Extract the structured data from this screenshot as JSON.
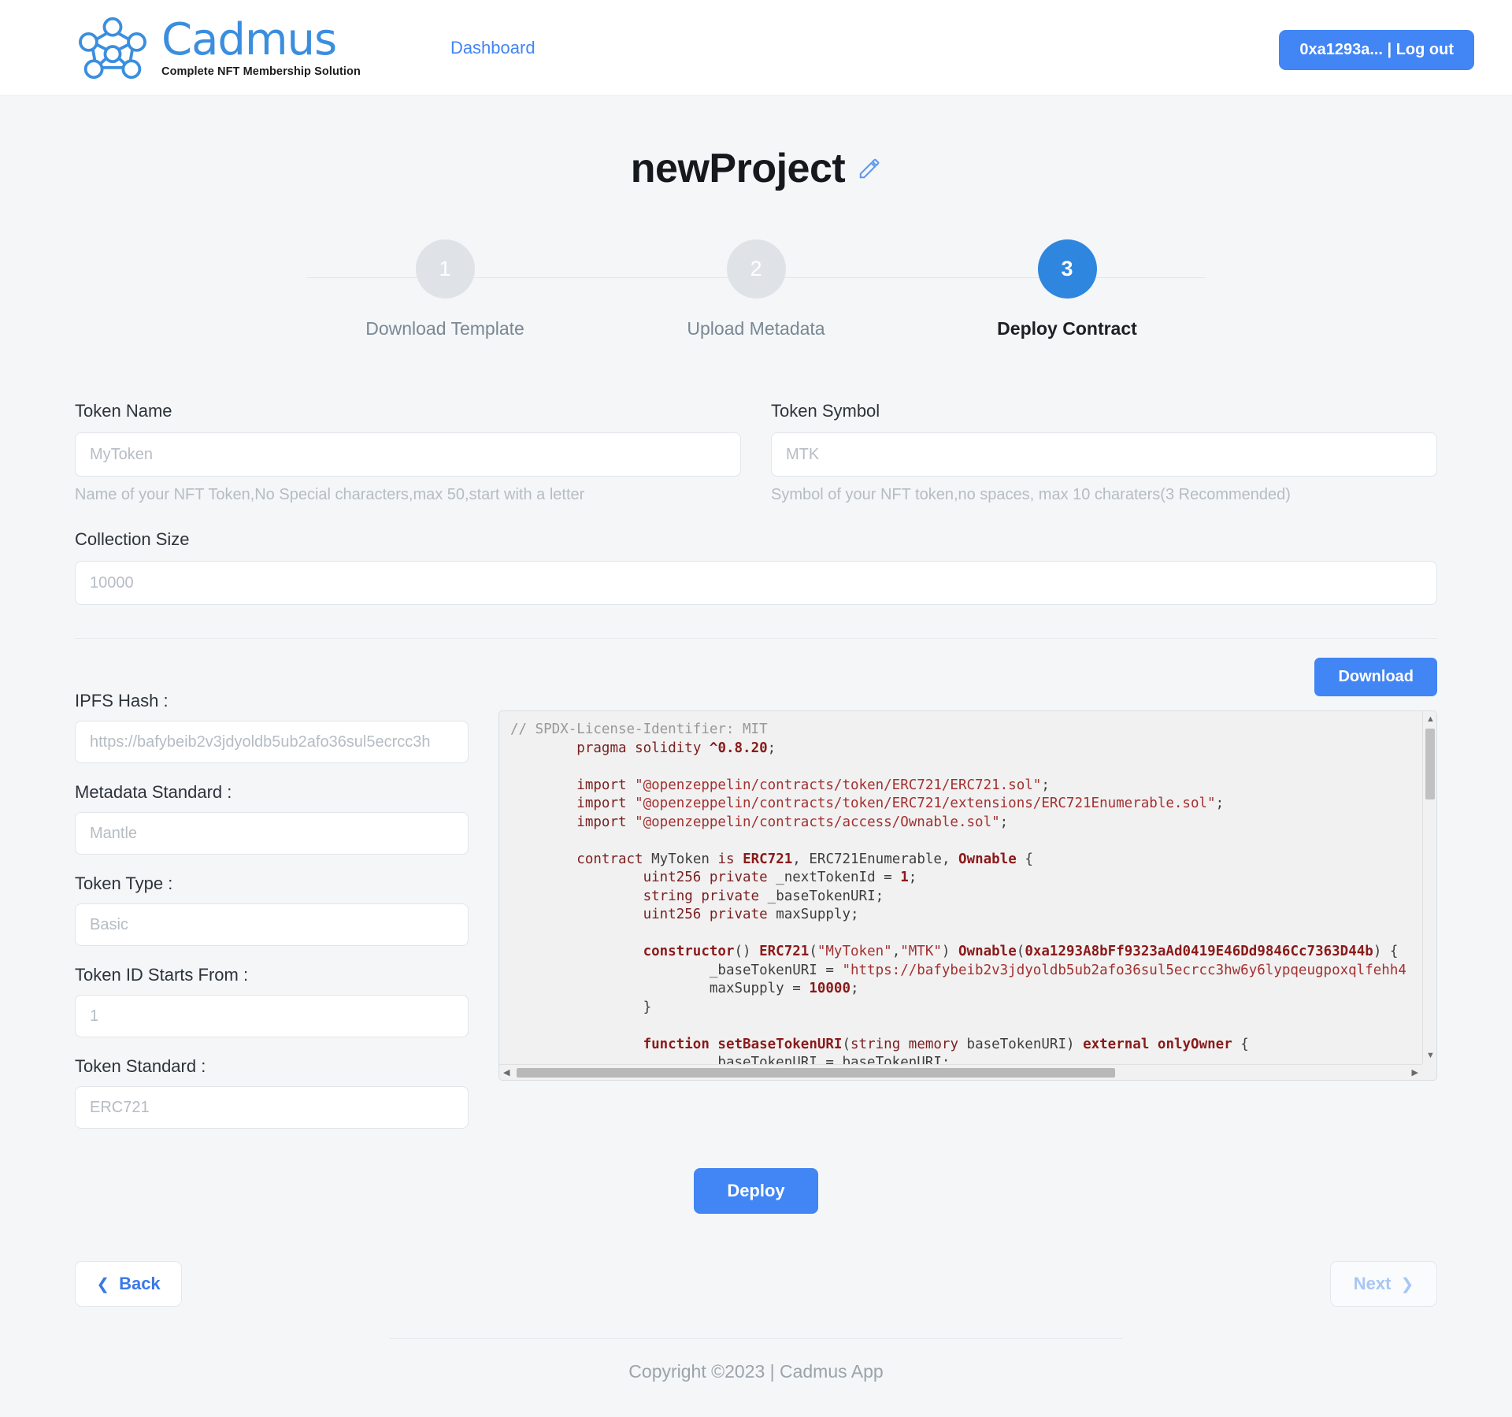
{
  "header": {
    "brand_word": "Cadmus",
    "brand_tagline": "Complete NFT Membership Solution",
    "nav_dashboard": "Dashboard",
    "account_button": "0xa1293a... | Log out",
    "logo_icon": "network-nodes-icon"
  },
  "project": {
    "title": "newProject",
    "edit_icon": "pencil-edit-icon"
  },
  "stepper": {
    "steps": [
      {
        "number": "1",
        "label": "Download Template",
        "active": false
      },
      {
        "number": "2",
        "label": "Upload Metadata",
        "active": false
      },
      {
        "number": "3",
        "label": "Deploy Contract",
        "active": true
      }
    ]
  },
  "form": {
    "token_name": {
      "label": "Token Name",
      "placeholder": "MyToken",
      "value": "",
      "helper": "Name of your NFT Token,No Special characters,max 50,start with a letter"
    },
    "token_symbol": {
      "label": "Token Symbol",
      "placeholder": "MTK",
      "value": "",
      "helper": "Symbol of your NFT token,no spaces, max 10 charaters(3 Recommended)"
    },
    "collection_size": {
      "label": "Collection Size",
      "placeholder": "10000",
      "value": ""
    }
  },
  "deploy_panel": {
    "download_label": "Download",
    "fields": [
      {
        "label": "IPFS Hash :",
        "placeholder": "https://bafybeib2v3jdyoldb5ub2afo36sul5ecrcc3h",
        "value": ""
      },
      {
        "label": "Metadata Standard :",
        "placeholder": "Mantle",
        "value": ""
      },
      {
        "label": "Token Type :",
        "placeholder": "Basic",
        "value": ""
      },
      {
        "label": "Token ID Starts From :",
        "placeholder": "1",
        "value": ""
      },
      {
        "label": "Token Standard :",
        "placeholder": "ERC721",
        "value": ""
      }
    ],
    "code": {
      "language": "solidity",
      "lines": [
        "// SPDX-License-Identifier: MIT",
        "        pragma solidity ^0.8.20;",
        "",
        "        import \"@openzeppelin/contracts/token/ERC721/ERC721.sol\";",
        "        import \"@openzeppelin/contracts/token/ERC721/extensions/ERC721Enumerable.sol\";",
        "        import \"@openzeppelin/contracts/access/Ownable.sol\";",
        "",
        "        contract MyToken is ERC721, ERC721Enumerable, Ownable {",
        "                uint256 private _nextTokenId = 1;",
        "                string private _baseTokenURI;",
        "                uint256 private maxSupply;",
        "",
        "                constructor() ERC721(\"MyToken\",\"MTK\") Ownable(0xa1293A8bFf9323aAd0419E46Dd9846Cc7363D44b) {",
        "                        _baseTokenURI = \"https://bafybeib2v3jdyoldb5ub2afo36sul5ecrcc3hw6y6lypqeugpoxqlfehh4",
        "                        maxSupply = 10000;",
        "                }",
        "",
        "                function setBaseTokenURI(string memory baseTokenURI) external onlyOwner {",
        "                        _baseTokenURI = baseTokenURI;",
        "                }"
      ],
      "contract_owner_address": "0xa1293A8bFf9323aAd0419E46Dd9846Cc7363D44b",
      "token_name_literal": "MyToken",
      "token_symbol_literal": "MTK",
      "max_supply_literal": "10000",
      "next_token_id_literal": "1",
      "solidity_version": "^0.8.20"
    }
  },
  "actions": {
    "deploy_label": "Deploy",
    "back_label": "Back",
    "next_label": "Next",
    "back_icon": "chevron-left-icon",
    "next_icon": "chevron-right-icon"
  },
  "footer": {
    "copyright": "Copyright ©2023 | Cadmus App"
  },
  "colors": {
    "accent": "#4285f4",
    "accent_step": "#2e86de",
    "brand_blue": "#3b8ede",
    "page_bg": "#f4f6f8",
    "code_bg": "#f1f1f1"
  }
}
